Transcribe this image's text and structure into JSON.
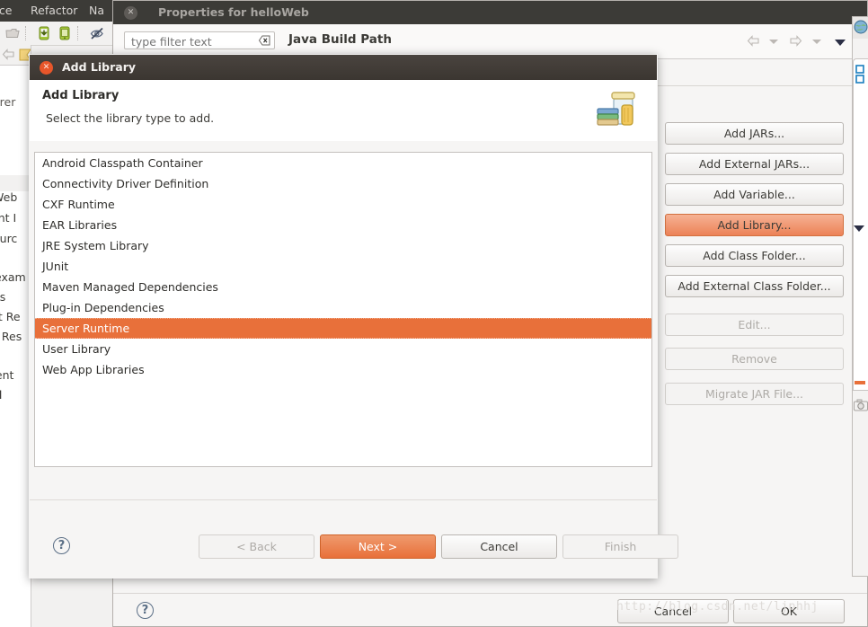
{
  "ide": {
    "menu": [
      {
        "label": "rce"
      },
      {
        "label": "Refactor"
      },
      {
        "label": "Na"
      }
    ],
    "toolbar_icons": [
      "export-folder-icon",
      "android-download-icon",
      "android-device-icon",
      "hide-disabled-icon"
    ],
    "left_panel": {
      "nav_back_icon": "back-arrow-icon",
      "nav_marker_icon": "bookmark-icon",
      "explorer_label": "orer",
      "rows": [
        "Web",
        "ent I",
        "ourc",
        "exam",
        "es",
        "pt Re",
        "d Res",
        "tent",
        "l"
      ]
    }
  },
  "properties_window": {
    "title": "Properties for helloWeb",
    "close_icon": "close-icon",
    "filter": {
      "placeholder": "type filter text",
      "value": "",
      "clear_icon": "clear-field-icon"
    },
    "page_title": "Java Build Path",
    "nav": {
      "back_icon": "back-arrow-icon",
      "back_menu_icon": "chevron-down-icon",
      "forward_icon": "forward-arrow-icon",
      "forward_menu_icon": "chevron-down-icon",
      "view_menu_icon": "chevron-down-icon"
    },
    "side_buttons": [
      {
        "label": "Add JARs...",
        "state": "normal"
      },
      {
        "label": "Add External JARs...",
        "state": "normal"
      },
      {
        "label": "Add Variable...",
        "state": "normal"
      },
      {
        "label": "Add Library...",
        "state": "accent"
      },
      {
        "label": "Add Class Folder...",
        "state": "normal"
      },
      {
        "label": "Add External Class Folder...",
        "state": "normal"
      },
      {
        "label": "Edit...",
        "state": "disabled"
      },
      {
        "label": "Remove",
        "state": "disabled"
      },
      {
        "label": "Migrate JAR File...",
        "state": "disabled"
      }
    ],
    "footer": {
      "help_icon": "help-icon",
      "help_glyph": "?",
      "cancel_label": "Cancel",
      "ok_label": "OK"
    }
  },
  "add_library_dialog": {
    "window_title": "Add Library",
    "close_icon": "close-icon",
    "heading": "Add Library",
    "subheading": "Select the library type to add.",
    "banner_icon": "library-jar-books-icon",
    "library_types": [
      "Android Classpath Container",
      "Connectivity Driver Definition",
      "CXF Runtime",
      "EAR Libraries",
      "JRE System Library",
      "JUnit",
      "Maven Managed Dependencies",
      "Plug-in Dependencies",
      "Server Runtime",
      "User Library",
      "Web App Libraries"
    ],
    "selected_library": "Server Runtime",
    "footer": {
      "help_icon": "help-icon",
      "help_glyph": "?",
      "back_label": "< Back",
      "next_label": "Next >",
      "cancel_label": "Cancel",
      "finish_label": "Finish"
    }
  },
  "watermark": "http://blog.csdn.net/ljphhj",
  "colors": {
    "selection_orange": "#e8703a",
    "accent_button": "#ec8257",
    "titlebar_dark": "#3c3b37",
    "dialog_titlebar": "#453f3a",
    "close_button_red": "#e8562a"
  }
}
